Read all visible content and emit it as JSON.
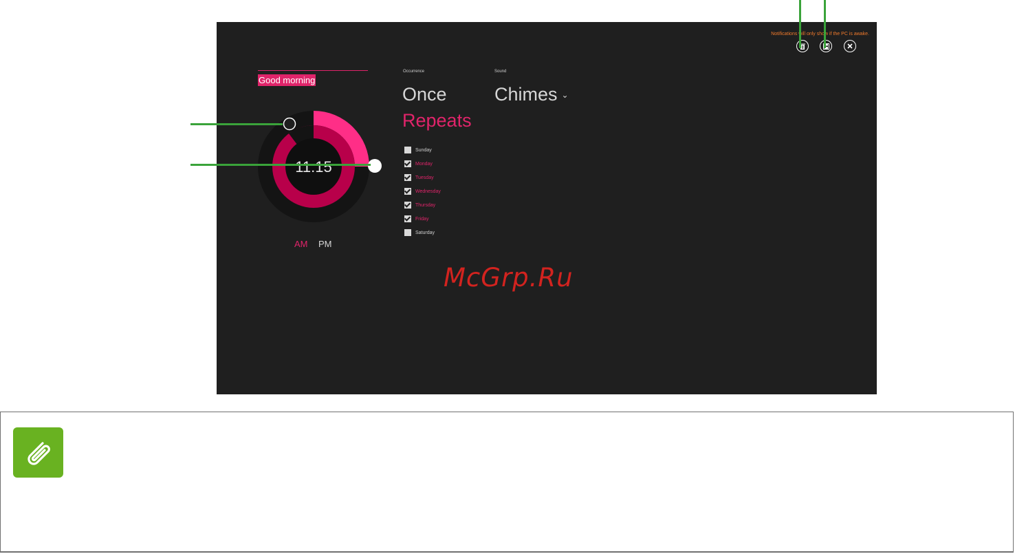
{
  "notification_text": "Notifications will only show if the PC is awake.",
  "toolbar": {
    "delete_icon": "trash-icon",
    "save_icon": "save-icon",
    "close_icon": "close-icon"
  },
  "alarm": {
    "name": "Good morning",
    "time": "11:15",
    "am_label": "AM",
    "pm_label": "PM",
    "selected_period": "AM"
  },
  "occurrence": {
    "label": "Occurrence",
    "once": "Once",
    "repeats": "Repeats",
    "selected": "Repeats"
  },
  "sound": {
    "label": "Sound",
    "value": "Chimes"
  },
  "days": [
    {
      "label": "Sunday",
      "checked": false
    },
    {
      "label": "Monday",
      "checked": true
    },
    {
      "label": "Tuesday",
      "checked": true
    },
    {
      "label": "Wednesday",
      "checked": true
    },
    {
      "label": "Thursday",
      "checked": true
    },
    {
      "label": "Friday",
      "checked": true
    },
    {
      "label": "Saturday",
      "checked": false
    }
  ],
  "watermark": "McGrp.Ru",
  "colors": {
    "accent": "#e0246a",
    "background": "#1f1f1f",
    "callout": "#3aa33a",
    "note_icon": "#69b221",
    "notice": "#f07a2c"
  },
  "note_icon": "paperclip-icon"
}
